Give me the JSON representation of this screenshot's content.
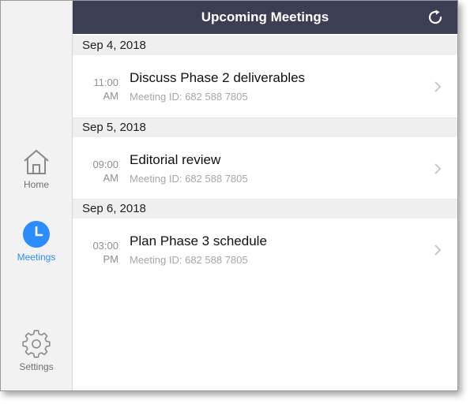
{
  "sidebar": {
    "items": [
      {
        "label": "Home",
        "icon": "home-icon"
      },
      {
        "label": "Meetings",
        "icon": "clock-icon",
        "active": true
      },
      {
        "label": "Settings",
        "icon": "gear-icon"
      }
    ]
  },
  "header": {
    "title": "Upcoming Meetings",
    "refresh_icon": "refresh-icon"
  },
  "sections": [
    {
      "date": "Sep 4, 2018",
      "meetings": [
        {
          "time": "11:00",
          "ampm": "AM",
          "topic": "Discuss Phase 2 deliverables",
          "meeting_id": "Meeting ID: 682 588 7805"
        }
      ]
    },
    {
      "date": "Sep 5, 2018",
      "meetings": [
        {
          "time": "09:00",
          "ampm": "AM",
          "topic": "Editorial review",
          "meeting_id": "Meeting ID: 682 588 7805"
        }
      ]
    },
    {
      "date": "Sep 6, 2018",
      "meetings": [
        {
          "time": "03:00",
          "ampm": "PM",
          "topic": "Plan Phase 3 schedule",
          "meeting_id": "Meeting ID: 682 588 7805"
        }
      ]
    }
  ],
  "colors": {
    "header_bg": "#3c3e53",
    "accent": "#2d8cff",
    "sidebar_bg": "#f2f2f2",
    "section_bg": "#efefef"
  }
}
